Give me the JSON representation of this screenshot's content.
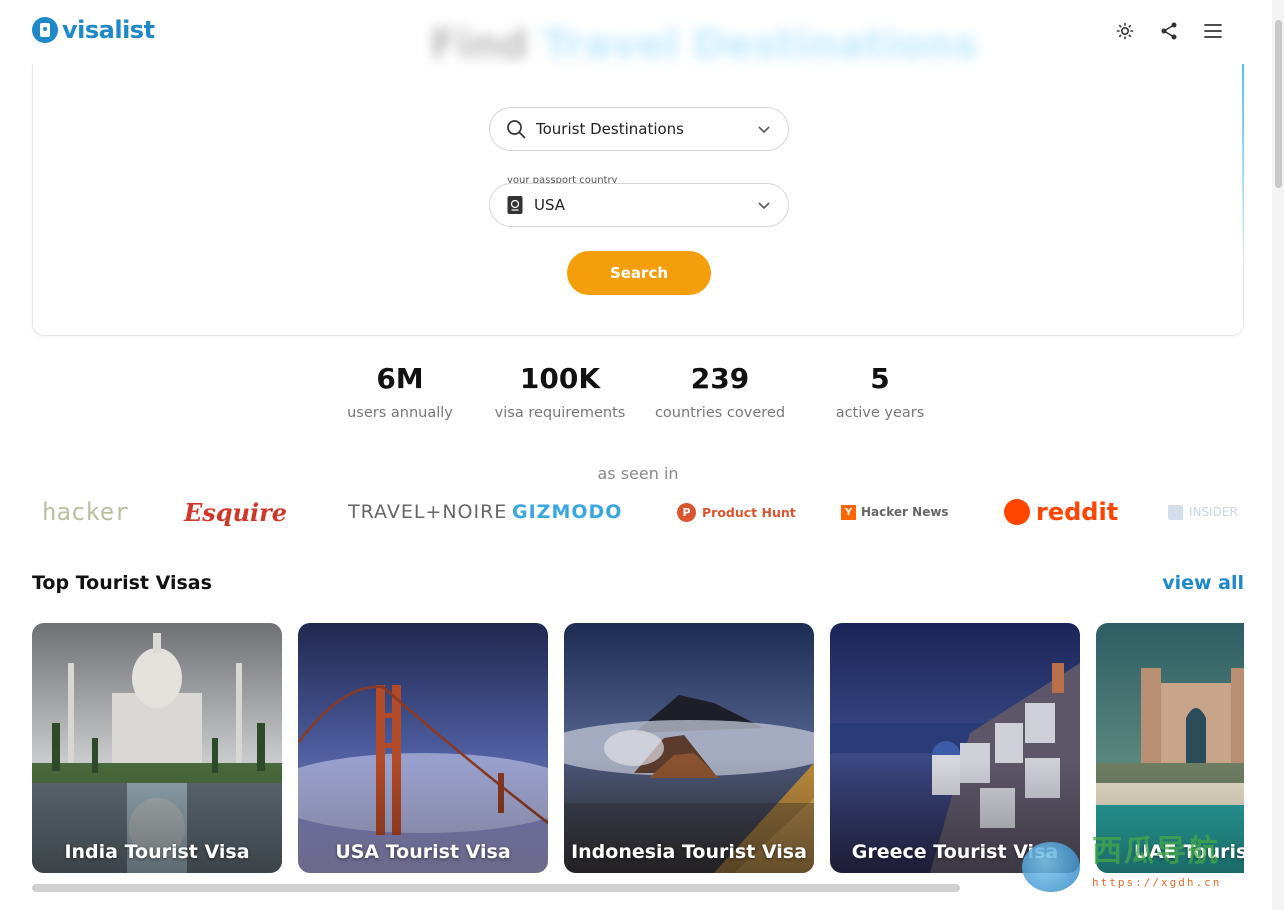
{
  "header": {
    "logo_text": "visalist",
    "ghost_title_a": "Find",
    "ghost_title_b": "Travel Destinations",
    "icons": [
      "theme-toggle-icon",
      "share-icon",
      "menu-icon"
    ]
  },
  "search": {
    "destination_value": "Tourist Destinations",
    "passport_label": "your passport country",
    "passport_value": "USA",
    "button_label": "Search"
  },
  "stats": [
    {
      "value": "6M",
      "label": "users annually"
    },
    {
      "value": "100K",
      "label": "visa requirements"
    },
    {
      "value": "239",
      "label": "countries covered"
    },
    {
      "value": "5",
      "label": "active years"
    }
  ],
  "seen_in": {
    "heading": "as seen in",
    "brands": [
      "hacker",
      "Esquire",
      "TRAVEL+NOIRE",
      "GIZMODO",
      "Product Hunt",
      "Hacker News",
      "reddit",
      "INSIDER"
    ]
  },
  "top_visas": {
    "title": "Top Tourist Visas",
    "view_all": "view all",
    "cards": [
      {
        "label": "India Tourist Visa"
      },
      {
        "label": "USA Tourist Visa"
      },
      {
        "label": "Indonesia Tourist Visa"
      },
      {
        "label": "Greece Tourist Visa"
      },
      {
        "label": "UAE Tourist Visa"
      }
    ]
  },
  "watermark": {
    "text": "西瓜导航",
    "url": "https://xgdh.cn"
  },
  "colors": {
    "brand": "#1e88c8",
    "accent": "#f59e0b"
  }
}
